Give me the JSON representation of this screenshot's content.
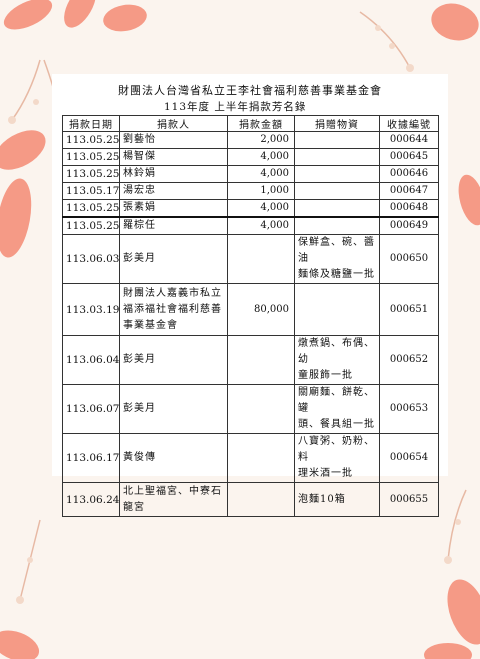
{
  "header": {
    "title": "財團法人台灣省私立王李社會福利慈善事業基金會",
    "subtitle": "113年度 上半年捐款芳名錄"
  },
  "table": {
    "columns": [
      "捐款日期",
      "捐款人",
      "捐款金額",
      "捐贈物資",
      "收據編號"
    ],
    "rows": [
      {
        "date": "113.05.25",
        "donor": "劉藝怡",
        "amount": "2,000",
        "goods": "",
        "receipt": "000644"
      },
      {
        "date": "113.05.25",
        "donor": "楊智傑",
        "amount": "4,000",
        "goods": "",
        "receipt": "000645"
      },
      {
        "date": "113.05.25",
        "donor": "林鈴娟",
        "amount": "4,000",
        "goods": "",
        "receipt": "000646"
      },
      {
        "date": "113.05.17",
        "donor": "湯宏忠",
        "amount": "1,000",
        "goods": "",
        "receipt": "000647"
      },
      {
        "date": "113.05.25",
        "donor": "張素娟",
        "amount": "4,000",
        "goods": "",
        "receipt": "000648"
      },
      {
        "date": "113.05.25",
        "donor": "羅棕任",
        "amount": "4,000",
        "goods": "",
        "receipt": "000649"
      },
      {
        "date": "113.06.03",
        "donor": "彭美月",
        "amount": "",
        "goods": "保鮮盒、碗、醬油\n麵條及糖鹽一批",
        "receipt": "000650"
      },
      {
        "date": "113.03.19",
        "donor": "財團法人嘉義市私立\n福添福社會福利慈善\n事業基金會",
        "amount": "80,000",
        "goods": "",
        "receipt": "000651"
      },
      {
        "date": "113.06.04",
        "donor": "彭美月",
        "amount": "",
        "goods": "燉煮鍋、布偶、幼\n童服飾一批",
        "receipt": "000652"
      },
      {
        "date": "113.06.07",
        "donor": "彭美月",
        "amount": "",
        "goods": "關廟麵、餅乾、罐\n頭、餐具組一批",
        "receipt": "000653"
      },
      {
        "date": "113.06.17",
        "donor": "黃俊傳",
        "amount": "",
        "goods": "八寶粥、奶粉、料\n理米酒一批",
        "receipt": "000654"
      },
      {
        "date": "113.06.24",
        "donor": "北上聖福宮、中寮石\n龍宮",
        "amount": "",
        "goods": "泡麵10箱",
        "receipt": "000655"
      }
    ]
  }
}
